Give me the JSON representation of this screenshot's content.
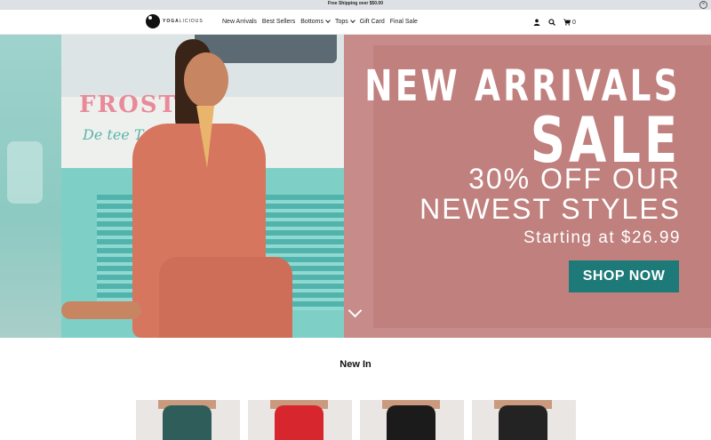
{
  "announcement": {
    "text": "Free Shipping over $50.00",
    "close_icon": "close-icon"
  },
  "header": {
    "logo_text_bold": "YOGA",
    "logo_text": "LICIOUS",
    "nav": [
      {
        "label": "New Arrivals",
        "has_dropdown": false
      },
      {
        "label": "Best Sellers",
        "has_dropdown": false
      },
      {
        "label": "Bottoms",
        "has_dropdown": true
      },
      {
        "label": "Tops",
        "has_dropdown": true
      },
      {
        "label": "Gift Card",
        "has_dropdown": false
      },
      {
        "label": "Final Sale",
        "has_dropdown": false
      }
    ],
    "icons": [
      "user-icon",
      "search-icon",
      "cart-icon"
    ],
    "cart_count": "0"
  },
  "hero": {
    "sign_big": "FROSTE",
    "sign_small": "De  tee Treat",
    "headline_line1": "NEW ARRIVALS",
    "headline_line2": "SALE",
    "offer_line1": "30% OFF OUR",
    "offer_line2": "NEWEST STYLES",
    "starting": "Starting at $26.99",
    "cta_label": "SHOP NOW",
    "colors": {
      "cta": "#1e7a78",
      "panel": "#c78b89"
    }
  },
  "new_in": {
    "title": "New In",
    "products": [
      {
        "garment_color": "#2f5d5a"
      },
      {
        "garment_color": "#d8262f"
      },
      {
        "garment_color": "#1b1b1b"
      },
      {
        "garment_color": "#232323"
      }
    ]
  }
}
